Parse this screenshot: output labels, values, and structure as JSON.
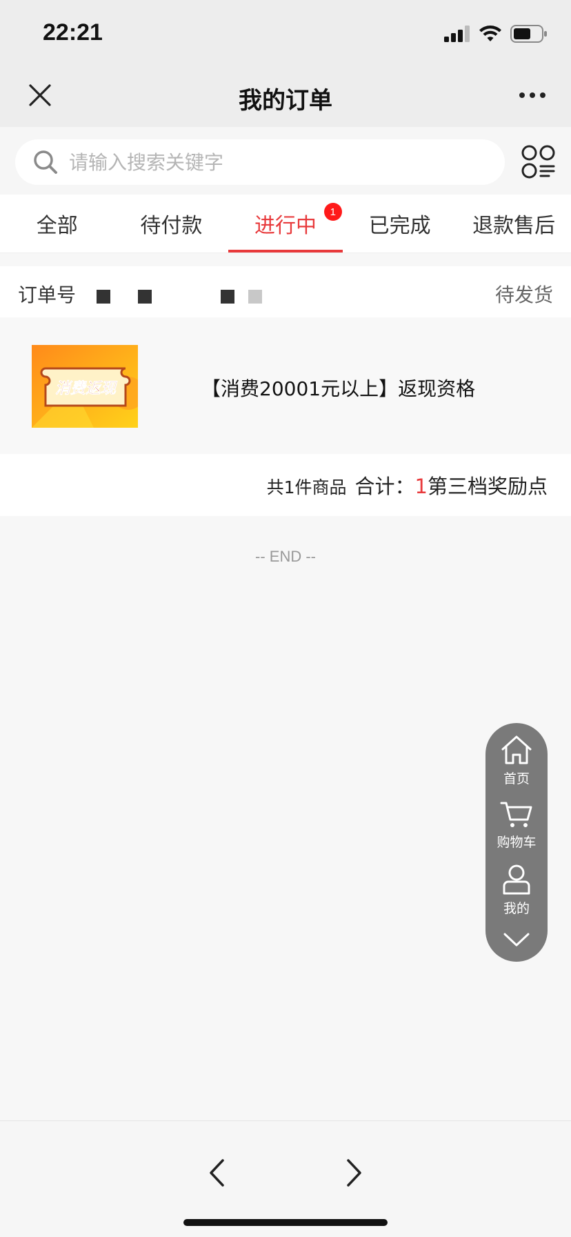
{
  "status_bar": {
    "time": "22:21"
  },
  "nav": {
    "title": "我的订单"
  },
  "search": {
    "placeholder": "请输入搜索关键字"
  },
  "tabs": [
    {
      "label": "全部"
    },
    {
      "label": "待付款"
    },
    {
      "label": "进行中",
      "badge": "1",
      "active": true
    },
    {
      "label": "已完成"
    },
    {
      "label": "退款售后"
    }
  ],
  "order": {
    "number_label": "订单号",
    "status": "待发货",
    "product": {
      "thumbnail_text": "消费返现",
      "name": "【消费20001元以上】返现资格"
    },
    "summary": {
      "count_text": "共1件商品",
      "total_label": "合计：",
      "total_value": "1",
      "total_unit": "第三档奖励点"
    }
  },
  "end_marker": "-- END --",
  "float_nav": {
    "items": [
      {
        "label": "首页"
      },
      {
        "label": "购物车"
      },
      {
        "label": "我的"
      }
    ]
  },
  "colors": {
    "accent": "#e8393b",
    "badge": "#ff1a1a",
    "float_bg": "#7a7a7a"
  }
}
